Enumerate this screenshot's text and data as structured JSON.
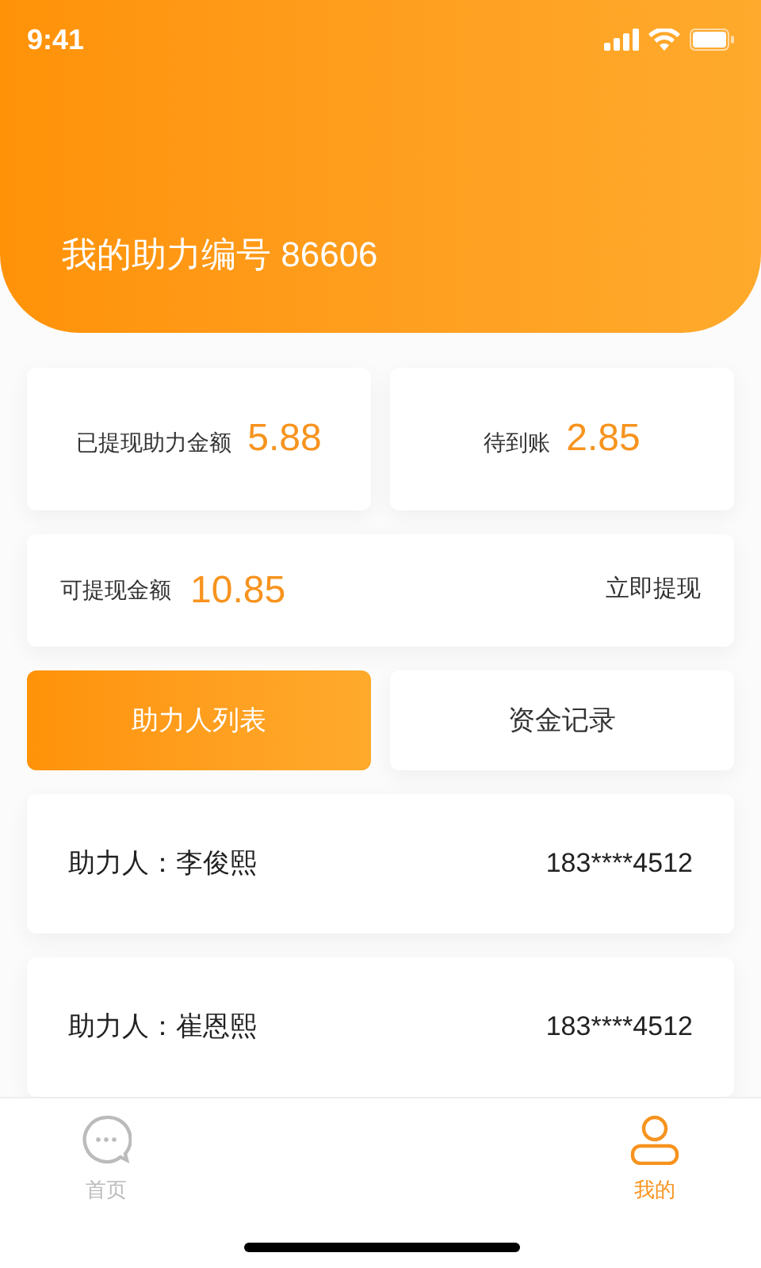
{
  "status_bar": {
    "time": "9:41"
  },
  "header": {
    "title": "我的助力编号 86606"
  },
  "stats": [
    {
      "label": "已提现助力金额",
      "value": "5.88"
    },
    {
      "label": "待到账",
      "value": "2.85"
    }
  ],
  "withdraw": {
    "label": "可提现金额",
    "value": "10.85",
    "action": "立即提现"
  },
  "tabs": [
    {
      "label": "助力人列表",
      "selected": true
    },
    {
      "label": "资金记录",
      "selected": false
    }
  ],
  "helpers": [
    {
      "name": "助力人：李俊熙",
      "phone": "183****4512"
    },
    {
      "name": "助力人：崔恩熙",
      "phone": "183****4512"
    }
  ],
  "tab_bar": [
    {
      "label": "首页",
      "kind": "chat",
      "selected": false
    },
    {
      "label": "我的",
      "kind": "person",
      "selected": true
    }
  ]
}
